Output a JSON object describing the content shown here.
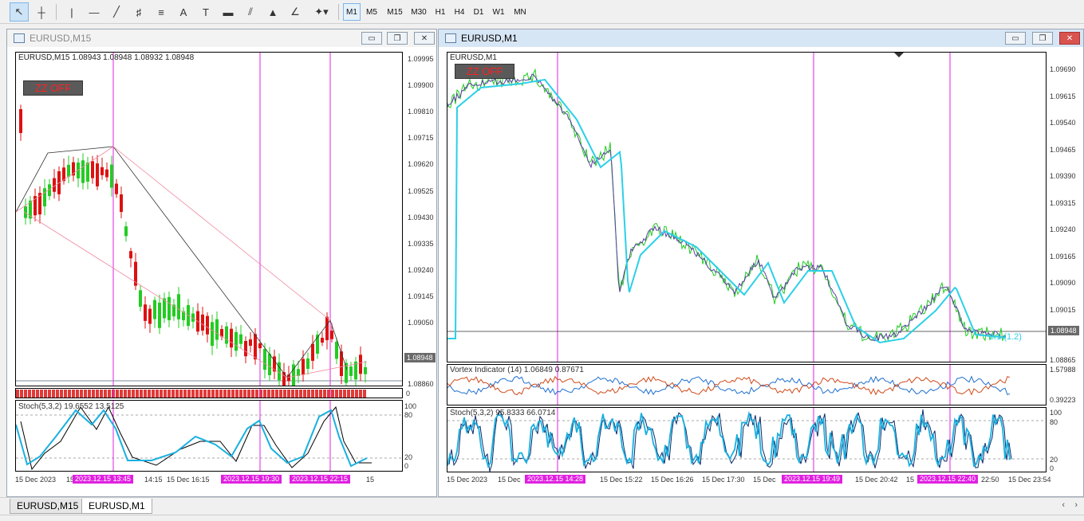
{
  "toolbar": {
    "tools": [
      {
        "name": "cursor-icon",
        "glyph": "↖"
      },
      {
        "name": "crosshair-icon",
        "glyph": "+"
      },
      {
        "name": "vertical-line-icon",
        "glyph": "|"
      },
      {
        "name": "horizontal-line-icon",
        "glyph": "—"
      },
      {
        "name": "trendline-icon",
        "glyph": "╱"
      },
      {
        "name": "channel-icon",
        "glyph": "♯"
      },
      {
        "name": "fibonacci-icon",
        "glyph": "≡"
      },
      {
        "name": "text-icon",
        "glyph": "A"
      },
      {
        "name": "text-label-icon",
        "glyph": "T"
      },
      {
        "name": "rectangle-icon",
        "glyph": "▬"
      },
      {
        "name": "gann-icon",
        "glyph": "⫽"
      },
      {
        "name": "triangle-icon",
        "glyph": "▲"
      },
      {
        "name": "angle-icon",
        "glyph": "∠"
      },
      {
        "name": "shapes-menu-icon",
        "glyph": "✦▾"
      }
    ],
    "timeframes": [
      "M1",
      "M5",
      "M15",
      "M30",
      "H1",
      "H4",
      "D1",
      "W1",
      "MN"
    ],
    "active_timeframe": "M1"
  },
  "left_window": {
    "title": "EURUSD,M15",
    "header": "EURUSD,M15  1.08943 1.08948 1.08932 1.08948",
    "zz_button": "ZZ OFF",
    "price_labels": [
      "1.09995",
      "1.09900",
      "1.09810",
      "1.09715",
      "1.09620",
      "1.09525",
      "1.09430",
      "1.09335",
      "1.09240",
      "1.09145",
      "1.09050",
      "1.08860"
    ],
    "last_price": "1.08948",
    "sub_indicator_value": "0",
    "stoch_header": "Stoch(5,3,2) 19.6552 13.5125",
    "stoch_levels": [
      "100",
      "80",
      "20",
      "0"
    ],
    "time_labels": [
      "15 Dec 2023",
      "15",
      "14:15",
      "15 Dec 16:15",
      "15 Dec",
      "15"
    ],
    "time_markers": [
      "2023.12.15 13:45",
      "2023.12.15 19:30",
      "2023.12.15 22:15"
    ]
  },
  "right_window": {
    "title": "EURUSD,M1",
    "header": "EURUSD,M1",
    "zz_button": "ZZ OFF",
    "price_labels": [
      "1.09690",
      "1.09615",
      "1.09540",
      "1.09465",
      "1.09390",
      "1.09315",
      "1.09240",
      "1.09165",
      "1.09090",
      "1.09015",
      "1.08865"
    ],
    "last_price": "1.08948",
    "fib_label": "0.1 (1.2)",
    "vortex_header": "Vortex Indicator (14) 1.06849 0.87671",
    "vortex_levels": [
      "1.57988",
      "0.39223"
    ],
    "stoch_header": "Stoch(5,3,2) 95.8333 66.0714",
    "stoch_levels": [
      "100",
      "80",
      "20",
      "0"
    ],
    "time_labels": [
      "15 Dec 2023",
      "15 Dec",
      "15 Dec 15:22",
      "15 Dec 16:26",
      "15 Dec 17:30",
      "15 Dec",
      "15 Dec 20:42",
      "15",
      "22:50",
      "15 Dec 23:54"
    ],
    "time_markers": [
      "2023.12.15 14:28",
      "2023.12.15 19:49",
      "2023.12.15 22:40"
    ]
  },
  "tabs": [
    "EURUSD,M15",
    "EURUSD,M1"
  ],
  "active_tab": "EURUSD,M1",
  "colors": {
    "bull": "#22cc22",
    "bear": "#dd1111",
    "marker": "#e020e0",
    "stoch_main": "#1ab0e0",
    "stoch_signal": "#000000",
    "vortex_plus": "#1f6fd1",
    "vortex_minus": "#d04a1a",
    "ma_line": "#2bd0e8"
  }
}
